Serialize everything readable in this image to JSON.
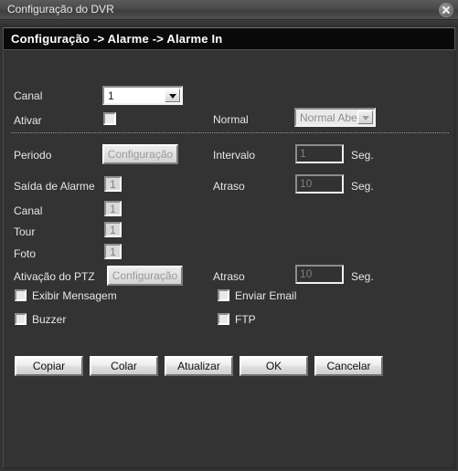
{
  "window": {
    "title": "Configuração do DVR",
    "close_icon": "close-icon"
  },
  "header": {
    "breadcrumb": "Configuração -> Alarme -> Alarme In"
  },
  "form": {
    "canal_top": {
      "label": "Canal",
      "value": "1"
    },
    "ativar": {
      "label": "Ativar",
      "checked": false
    },
    "normal": {
      "label": "Normal",
      "value": "Normal Aberto",
      "disabled": true
    },
    "periodo": {
      "label": "Periodo",
      "button_label": "Configuração",
      "disabled": true
    },
    "intervalo": {
      "label": "Intervalo",
      "value": "1",
      "unit": "Seg.",
      "disabled": true
    },
    "saida_alarme": {
      "label": "Saída de Alarme",
      "value": "1",
      "disabled": true
    },
    "atraso_1": {
      "label": "Atraso",
      "value": "10",
      "unit": "Seg.",
      "disabled": true
    },
    "canal_mid": {
      "label": "Canal",
      "value": "1",
      "disabled": true
    },
    "tour": {
      "label": "Tour",
      "value": "1",
      "disabled": true
    },
    "foto": {
      "label": "Foto",
      "value": "1",
      "disabled": true
    },
    "ptz": {
      "label": "Ativação do PTZ",
      "button_label": "Configuração",
      "disabled": true
    },
    "atraso_2": {
      "label": "Atraso",
      "value": "10",
      "unit": "Seg.",
      "disabled": true
    },
    "checks": {
      "exibir_mensagem": {
        "label": "Exibir Mensagem",
        "checked": false
      },
      "enviar_email": {
        "label": "Enviar Email",
        "checked": false
      },
      "buzzer": {
        "label": "Buzzer",
        "checked": false
      },
      "ftp": {
        "label": "FTP",
        "checked": false
      }
    }
  },
  "actions": {
    "copiar": "Copiar",
    "colar": "Colar",
    "atualizar": "Atualizar",
    "ok": "OK",
    "cancelar": "Cancelar"
  },
  "colors": {
    "window_bg": "#333333",
    "header_bg": "#0a0a0a",
    "text": "#e6e6e6",
    "divider": "#9aa7c0",
    "button_face": "#ededed",
    "disabled_text": "#8d8d8d"
  }
}
